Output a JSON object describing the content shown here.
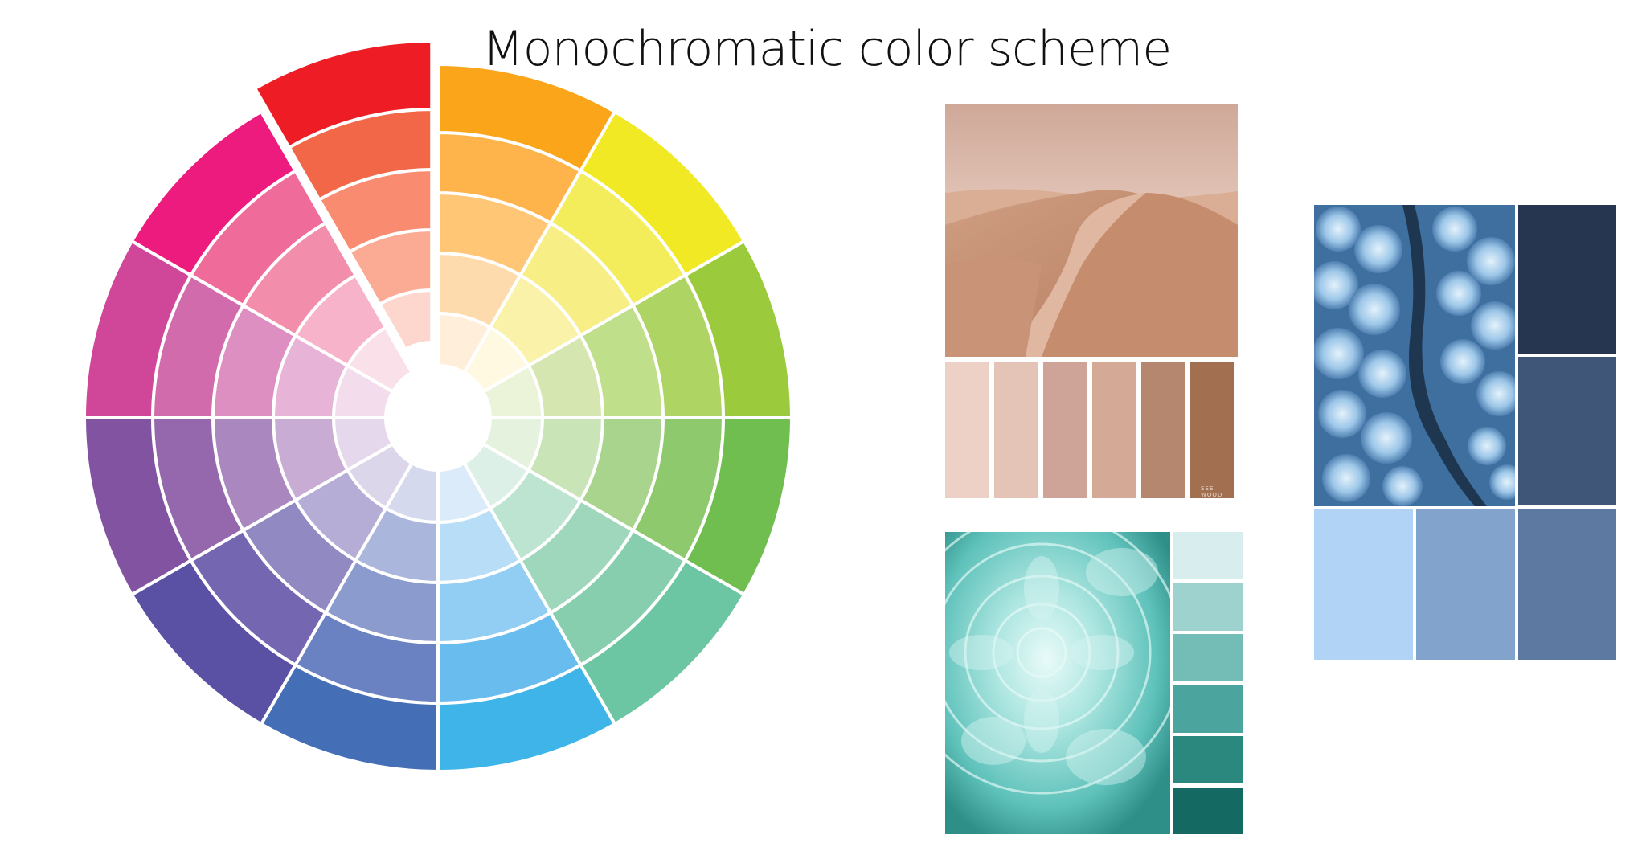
{
  "title": "Monochromatic color scheme",
  "wheel": {
    "hues": [
      {
        "name": "orange",
        "rings": [
          "#FFEED9",
          "#FEDBAC",
          "#FFC675",
          "#FEB44B",
          "#FBA51A"
        ]
      },
      {
        "name": "yellow",
        "rings": [
          "#FEF9E0",
          "#FAF2A8",
          "#F7EE85",
          "#F3EC5B",
          "#F1E923"
        ]
      },
      {
        "name": "yellow-green",
        "rings": [
          "#EBF3D8",
          "#D6E6B0",
          "#C0DF8B",
          "#AED563",
          "#9BCB3C"
        ]
      },
      {
        "name": "green",
        "rings": [
          "#E5F2DD",
          "#C9E4B6",
          "#A9D48D",
          "#8FC96D",
          "#6FBE4F"
        ]
      },
      {
        "name": "teal-green",
        "rings": [
          "#DDF0E7",
          "#BDE3D1",
          "#9FD7BD",
          "#86CEAD",
          "#6DC6A3"
        ]
      },
      {
        "name": "light-blue",
        "rings": [
          "#DCEBF9",
          "#B8DDF6",
          "#92CDF3",
          "#69BCEE",
          "#3FB4E8"
        ]
      },
      {
        "name": "blue",
        "rings": [
          "#D4D9EE",
          "#ABB6DD",
          "#8B9BCE",
          "#6A82C1",
          "#446EB5"
        ]
      },
      {
        "name": "indigo",
        "rings": [
          "#DCD6EA",
          "#B5ADD6",
          "#918AC2",
          "#7466B1",
          "#5B51A4"
        ]
      },
      {
        "name": "purple",
        "rings": [
          "#E5D8EC",
          "#C9ACD3",
          "#AB87BF",
          "#9567AD",
          "#8253A1"
        ]
      },
      {
        "name": "magenta",
        "rings": [
          "#F3DCEC",
          "#E7B3D7",
          "#DD8FC2",
          "#D26BAC",
          "#D0479A"
        ]
      },
      {
        "name": "pink",
        "rings": [
          "#FAE1E9",
          "#F7B3C9",
          "#F38DAC",
          "#EF6B9A",
          "#EC1B7D"
        ]
      },
      {
        "name": "red",
        "rings": [
          "#FDD7CE",
          "#FBAA94",
          "#F98B71",
          "#F36749",
          "#EE1D25"
        ]
      }
    ],
    "highlighted_hue": "red"
  },
  "palettes": {
    "desert": {
      "photo_alt": "desert dunes photo",
      "swatches": [
        "#EDD1C7",
        "#E5C4B8",
        "#CDA497",
        "#D4A996",
        "#B5876F",
        "#A36F51"
      ],
      "brand_mark": "SSE WOOD"
    },
    "flower": {
      "photo_alt": "teal dahlia flower photo",
      "swatches": [
        "#D8EDED",
        "#9DD2CF",
        "#73BDB6",
        "#4BA59E",
        "#2B887F",
        "#146A63"
      ]
    },
    "forest": {
      "photo_alt": "snowy forest aerial photo",
      "swatches_right": [
        "#273650",
        "#3F5679"
      ],
      "swatches_bottom": [
        "#B1D3F6",
        "#82A4CC",
        "#5D79A1"
      ]
    }
  }
}
